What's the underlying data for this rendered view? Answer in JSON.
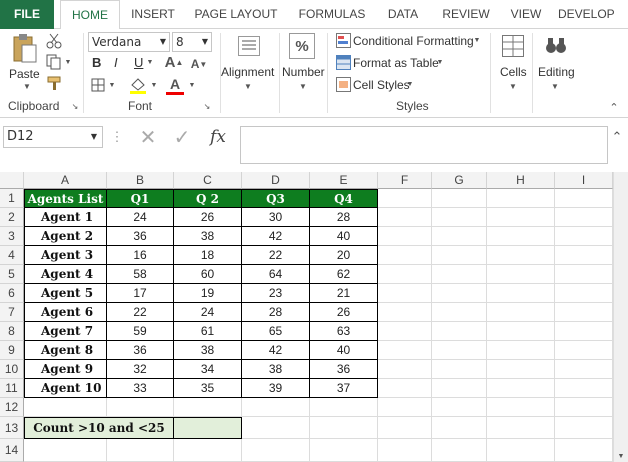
{
  "tabs": {
    "file": "FILE",
    "home": "HOME",
    "insert": "INSERT",
    "page_layout": "PAGE LAYOUT",
    "formulas": "FORMULAS",
    "data": "DATA",
    "review": "REVIEW",
    "view": "VIEW",
    "develop": "DEVELOP"
  },
  "ribbon": {
    "clipboard": {
      "paste": "Paste",
      "label": "Clipboard"
    },
    "font": {
      "name": "Verdana",
      "size": "8",
      "bold": "B",
      "italic": "I",
      "underline": "U",
      "label": "Font"
    },
    "alignment": "Alignment",
    "number": "Number",
    "styles": {
      "conditional": "Conditional Formatting",
      "format_table": "Format as Table",
      "cell_styles": "Cell Styles",
      "label": "Styles"
    },
    "cells": "Cells",
    "editing": "Editing"
  },
  "formula_bar": {
    "name_box": "D12",
    "value": ""
  },
  "columns": [
    "A",
    "B",
    "C",
    "D",
    "E",
    "F",
    "G",
    "H",
    "I"
  ],
  "rows": [
    "1",
    "2",
    "3",
    "4",
    "5",
    "6",
    "7",
    "8",
    "9",
    "10",
    "11",
    "12",
    "13",
    "14"
  ],
  "table": {
    "headers": [
      "Agents List",
      "Q1",
      "Q 2",
      "Q3",
      "Q4"
    ],
    "data": [
      [
        "Agent 1",
        "24",
        "26",
        "30",
        "28"
      ],
      [
        "Agent 2",
        "36",
        "38",
        "42",
        "40"
      ],
      [
        "Agent 3",
        "16",
        "18",
        "22",
        "20"
      ],
      [
        "Agent 4",
        "58",
        "60",
        "64",
        "62"
      ],
      [
        "Agent 5",
        "17",
        "19",
        "23",
        "21"
      ],
      [
        "Agent 6",
        "22",
        "24",
        "28",
        "26"
      ],
      [
        "Agent 7",
        "59",
        "61",
        "65",
        "63"
      ],
      [
        "Agent 8",
        "36",
        "38",
        "42",
        "40"
      ],
      [
        "Agent 9",
        "32",
        "34",
        "38",
        "36"
      ],
      [
        "Agent 10",
        "33",
        "35",
        "39",
        "37"
      ]
    ]
  },
  "count_label": "Count >10 and <25",
  "colors": {
    "excel_green": "#217346",
    "header_green": "#0e7d1f",
    "count_fill": "#e2efda"
  }
}
